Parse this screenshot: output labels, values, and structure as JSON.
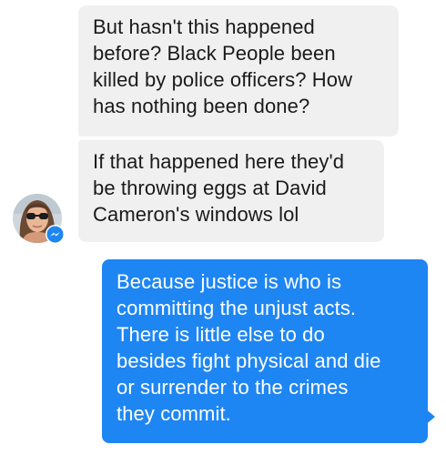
{
  "conversation": {
    "messages": [
      {
        "sender": "contact",
        "text": "But hasn't this happened\nbefore? Black People been\nkilled by police officers? How\nhas nothing been done?"
      },
      {
        "sender": "contact",
        "text": "If that happened here they'd\nbe throwing eggs at David\nCameron's windows lol"
      },
      {
        "sender": "me",
        "text": "Because justice is who is\ncommitting the unjust acts.\nThere is little else to do\nbesides fight physical and die\nor surrender to the crimes\nthey commit."
      }
    ]
  },
  "contact": {
    "avatar_icon": "profile-photo",
    "badge_icon": "messenger-icon"
  },
  "colors": {
    "incoming_bubble": "#f1f0f0",
    "outgoing_bubble": "#1e86f3",
    "incoming_text": "#1a1a1a",
    "outgoing_text": "#ffffff"
  }
}
